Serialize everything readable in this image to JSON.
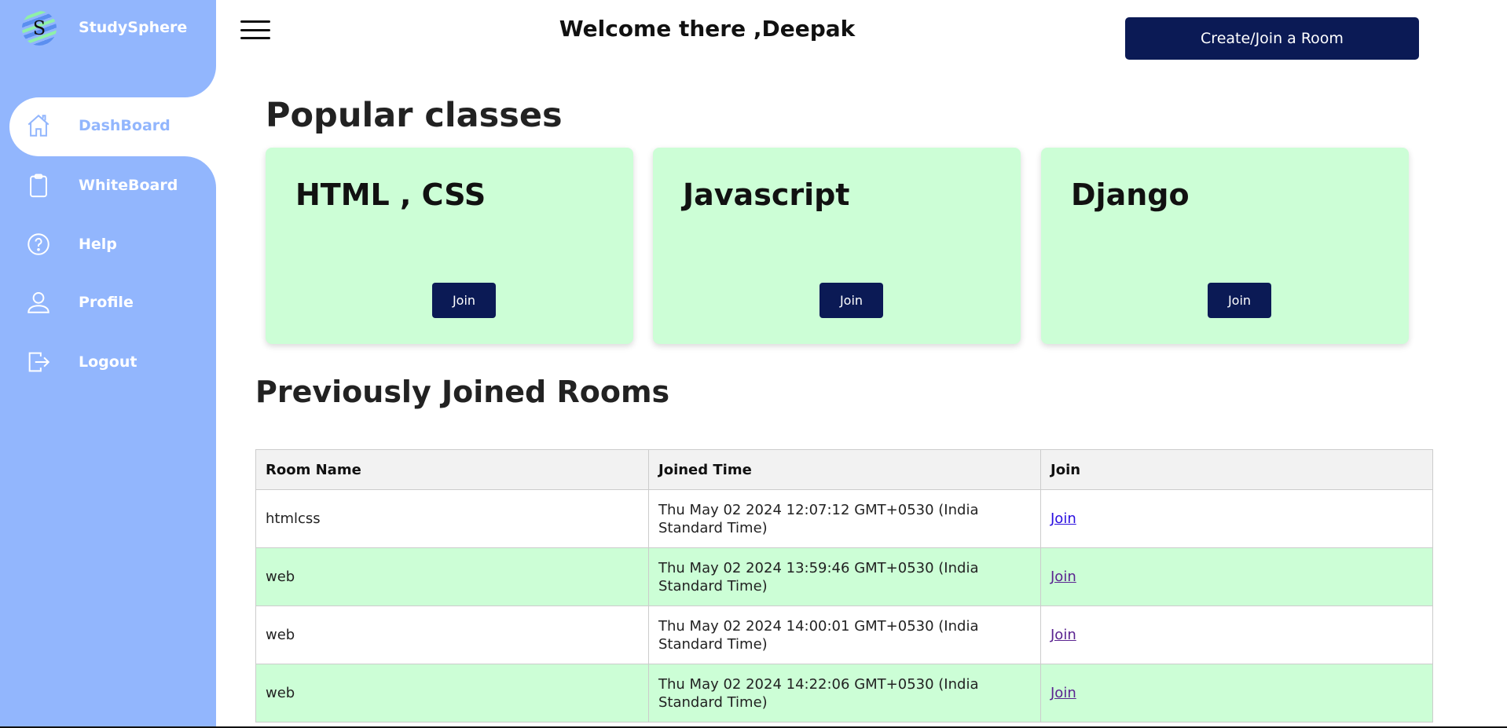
{
  "sidebar": {
    "brand": "StudySphere",
    "items": [
      {
        "label": "DashBoard",
        "icon": "home-icon",
        "active": true
      },
      {
        "label": "WhiteBoard",
        "icon": "clipboard-icon"
      },
      {
        "label": "Help",
        "icon": "help-circle-icon"
      },
      {
        "label": "Profile",
        "icon": "user-icon"
      },
      {
        "label": "Logout",
        "icon": "logout-icon"
      }
    ]
  },
  "header": {
    "welcome": "Welcome there ,Deepak",
    "create_join": "Create/Join a Room"
  },
  "popular": {
    "title": "Popular classes",
    "cards": [
      {
        "title": "HTML , CSS",
        "button": "Join"
      },
      {
        "title": "Javascript",
        "button": "Join"
      },
      {
        "title": "Django",
        "button": "Join"
      }
    ]
  },
  "rooms": {
    "title": "Previously Joined Rooms",
    "columns": [
      "Room Name",
      "Joined Time",
      "Join"
    ],
    "rows": [
      {
        "name": "htmlcss",
        "time": "Thu May 02 2024 12:07:12 GMT+0530 (India Standard Time)",
        "link": "Join"
      },
      {
        "name": "web",
        "time": "Thu May 02 2024 13:59:46 GMT+0530 (India Standard Time)",
        "link": "Join"
      },
      {
        "name": "web",
        "time": "Thu May 02 2024 14:00:01 GMT+0530 (India Standard Time)",
        "link": "Join"
      },
      {
        "name": "web",
        "time": "Thu May 02 2024 14:22:06 GMT+0530 (India Standard Time)",
        "link": "Join"
      }
    ]
  },
  "colors": {
    "sidebar": "#92b6fd",
    "accent": "#0b1a55",
    "card": "#ccfed6"
  }
}
